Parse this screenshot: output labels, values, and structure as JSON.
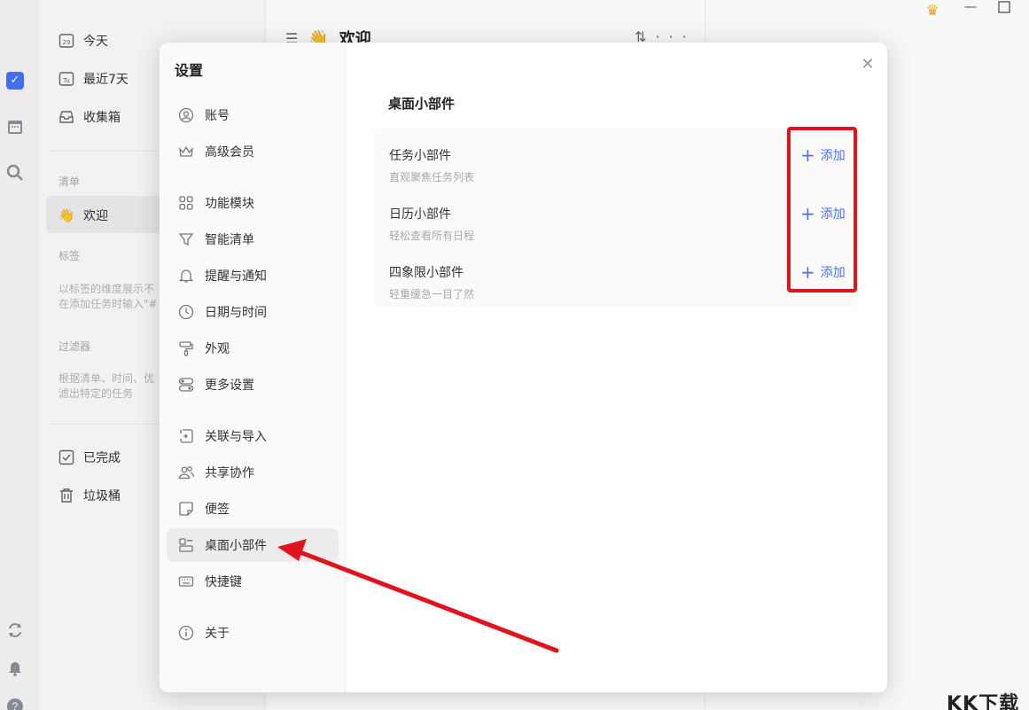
{
  "sidebar": {
    "items_top": [
      {
        "label": "今天",
        "icon": "calendar-day-icon",
        "glyph": "29"
      },
      {
        "label": "最近7天",
        "icon": "calendar-week-icon",
        "glyph": "Tu"
      },
      {
        "label": "收集箱",
        "icon": "inbox-icon",
        "glyph": "⌂"
      }
    ],
    "list_section": "清单",
    "welcome_item": "欢迎",
    "tags_section": "标签",
    "tags_hint": [
      "以标签的维度展示不",
      "在添加任务时输入\"#"
    ],
    "filter_section": "过滤器",
    "filter_hint": [
      "根据清单、时间、优",
      "滤出特定的任务"
    ],
    "items_bottom": [
      {
        "label": "已完成",
        "icon": "completed-icon"
      },
      {
        "label": "垃圾桶",
        "icon": "trash-icon"
      }
    ]
  },
  "main": {
    "title": "欢迎",
    "sort_glyph": "⇅",
    "more_glyph": "···"
  },
  "dialog": {
    "title": "设置",
    "nav": [
      {
        "label": "账号",
        "icon": "account-icon"
      },
      {
        "label": "高级会员",
        "icon": "premium-crown-icon"
      },
      {
        "label": "功能模块",
        "icon": "modules-icon"
      },
      {
        "label": "智能清单",
        "icon": "filter-funnel-icon"
      },
      {
        "label": "提醒与通知",
        "icon": "bell-icon"
      },
      {
        "label": "日期与时间",
        "icon": "clock-icon"
      },
      {
        "label": "外观",
        "icon": "paint-roller-icon"
      },
      {
        "label": "更多设置",
        "icon": "toggles-icon"
      },
      {
        "label": "关联与导入",
        "icon": "import-icon"
      },
      {
        "label": "共享协作",
        "icon": "users-icon"
      },
      {
        "label": "便签",
        "icon": "sticky-note-icon"
      },
      {
        "label": "桌面小部件",
        "icon": "widget-icon"
      },
      {
        "label": "快捷键",
        "icon": "keyboard-icon"
      },
      {
        "label": "关于",
        "icon": "info-icon"
      }
    ],
    "active_nav": "桌面小部件",
    "content_title": "桌面小部件",
    "widgets": [
      {
        "name": "任务小部件",
        "desc": "直观聚焦任务列表",
        "action": "添加"
      },
      {
        "name": "日历小部件",
        "desc": "轻松查看所有日程",
        "action": "添加"
      },
      {
        "name": "四象限小部件",
        "desc": "轻重缓急一目了然",
        "action": "添加"
      }
    ]
  },
  "watermark": "KK下载",
  "colors": {
    "accent": "#4772fa",
    "annotation": "#e0141e",
    "crown": "#f2a41e"
  }
}
